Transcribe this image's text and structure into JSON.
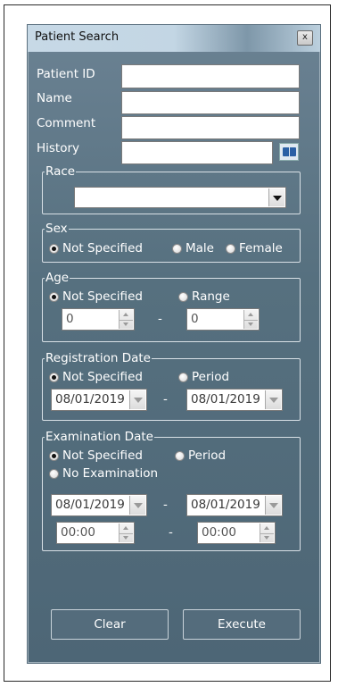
{
  "window": {
    "title": "Patient Search",
    "close_glyph": "x"
  },
  "fields": {
    "patient_id_label": "Patient ID",
    "name_label": "Name",
    "comment_label": "Comment",
    "history_label": "History",
    "patient_id_value": "",
    "name_value": "",
    "comment_value": "",
    "history_value": ""
  },
  "race": {
    "legend": "Race",
    "selected": ""
  },
  "sex": {
    "legend": "Sex",
    "options": [
      "Not Specified",
      "Male",
      "Female"
    ],
    "selected": "Not Specified"
  },
  "age": {
    "legend": "Age",
    "options": [
      "Not Specified",
      "Range"
    ],
    "selected": "Not Specified",
    "from": "0",
    "to": "0",
    "separator": "-"
  },
  "registration_date": {
    "legend": "Registration Date",
    "options": [
      "Not Specified",
      "Period"
    ],
    "selected": "Not Specified",
    "from": "08/01/2019",
    "to": "08/01/2019",
    "separator": "-"
  },
  "examination_date": {
    "legend": "Examination Date",
    "options": [
      "Not Specified",
      "Period",
      "No Examination"
    ],
    "selected": "Not Specified",
    "from_date": "08/01/2019",
    "to_date": "08/01/2019",
    "from_time": "00:00",
    "to_time": "00:00",
    "separator": "-"
  },
  "buttons": {
    "clear": "Clear",
    "execute": "Execute"
  },
  "colors": {
    "panel": "#56707f",
    "titlebar": "#c7d9e6",
    "label_text": "#ffffff"
  }
}
